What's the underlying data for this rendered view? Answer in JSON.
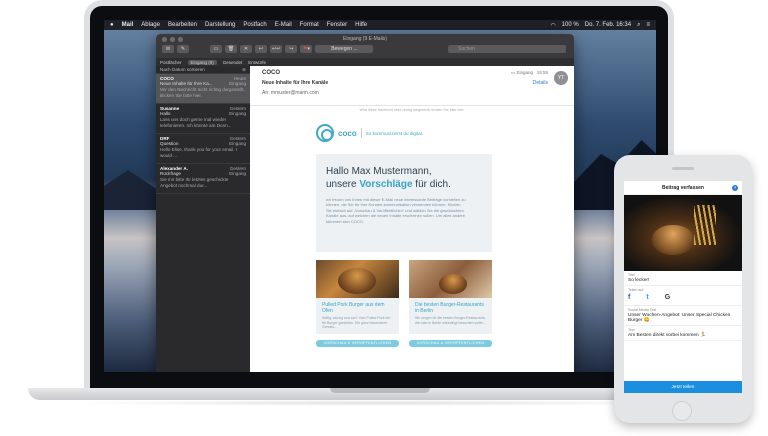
{
  "menubar": {
    "app": "Mail",
    "items": [
      "Ablage",
      "Bearbeiten",
      "Darstellung",
      "Postfach",
      "E-Mail",
      "Format",
      "Fenster",
      "Hilfe"
    ],
    "battery": "100 %",
    "clock": "Do. 7. Feb.  16:34"
  },
  "mail": {
    "window_title": "Eingang (9 E-Mails)",
    "search_placeholder": "Suchen",
    "move_label": "Bewegen ...",
    "favorites": [
      "Postfächer",
      "Eingang (9)",
      "Gesendet",
      "Entwürfe"
    ],
    "sort_label": "Nach Datum sortieren",
    "messages": [
      {
        "from": "COCO",
        "date": "Heute",
        "box": "Eingang",
        "subject": "Neue Inhalte für Ihre Ka...",
        "preview": "Wir den Nachricht nicht richtig dargestellt, klicken Sie bitte hier."
      },
      {
        "from": "Susanne",
        "date": "Gestern",
        "box": "Eingang",
        "subject": "Hallo",
        "preview": "Lass uns doch gerne mal wieder telefonieren. Ich könnte am Donn..."
      },
      {
        "from": "DRF",
        "date": "Gestern",
        "box": "Eingang",
        "subject": "Question",
        "preview": "Hello Elise, thank you for your email. I would ..."
      },
      {
        "from": "Alexander A.",
        "date": "Gestern",
        "box": "Eingang",
        "subject": "Rückfrage",
        "preview": "Sie mir bitte Ihr letztes geschickte Angebot nochmal dur..."
      }
    ],
    "reader": {
      "from": "COCO",
      "subject": "Neue Inhalte für Ihre Kanäle",
      "to_label": "An:",
      "to": "mmuster@mann.com",
      "mailbox": "Eingang",
      "time": "15:55",
      "details": "Details",
      "avatar": "YT",
      "notice": "Wird diese Nachricht nicht richtig dargestellt, klicken Sie bitte hier."
    },
    "newsletter": {
      "brand": "coco",
      "tagline": "So kommunizierst du digital.",
      "greeting": "Hallo Max Mustermann,",
      "headline_pre": "unsere ",
      "headline_hl": "Vorschläge",
      "headline_post": " für dich.",
      "body": "wir freuen uns Ihnen mit dieser E-Mail neue interessante Beiträge vorstellen zu können, die Sie für Ihre Kunden-kommunikation verwenden können. Klicken Sie einfach auf „Vorschau & Veröffentlichen“ und wählen Sie die gewünschten Kanäle aus, auf welchen die neuen Inhalte erscheinen sollen. Um alles andere kümmert sich COCO.",
      "cards": [
        {
          "title": "Pulled Pork Burger aus dem Ofen",
          "text": "Saftig, würzig und zart: Vom Pulled Pork wir für Burger genießen. Ein ganz besonderer Genuss..."
        },
        {
          "title": "Die besten Burger-Restaurants in Berlin",
          "text": "Wir zeigen dir die besten Burger-Restaurants, die man in Berlin unbedingt besuchen sollte..."
        }
      ],
      "button": "VORSCHAU & VERÖFFENTLICHEN"
    }
  },
  "phone": {
    "title": "Beitrag verfassen",
    "title_label": "Titel",
    "title_value": "So lecker!",
    "share_label": "Teilen auf",
    "social": [
      "f",
      "t",
      "G"
    ],
    "social_text_label": "Social-Media Text",
    "social_text": "Unser Wochen-Angebot: Unser Special Chicken Burger 😋",
    "text_label": "Text",
    "text_value": "Am Besten direkt vorbei kommen 🏃",
    "button": "Jetzt teilen"
  }
}
